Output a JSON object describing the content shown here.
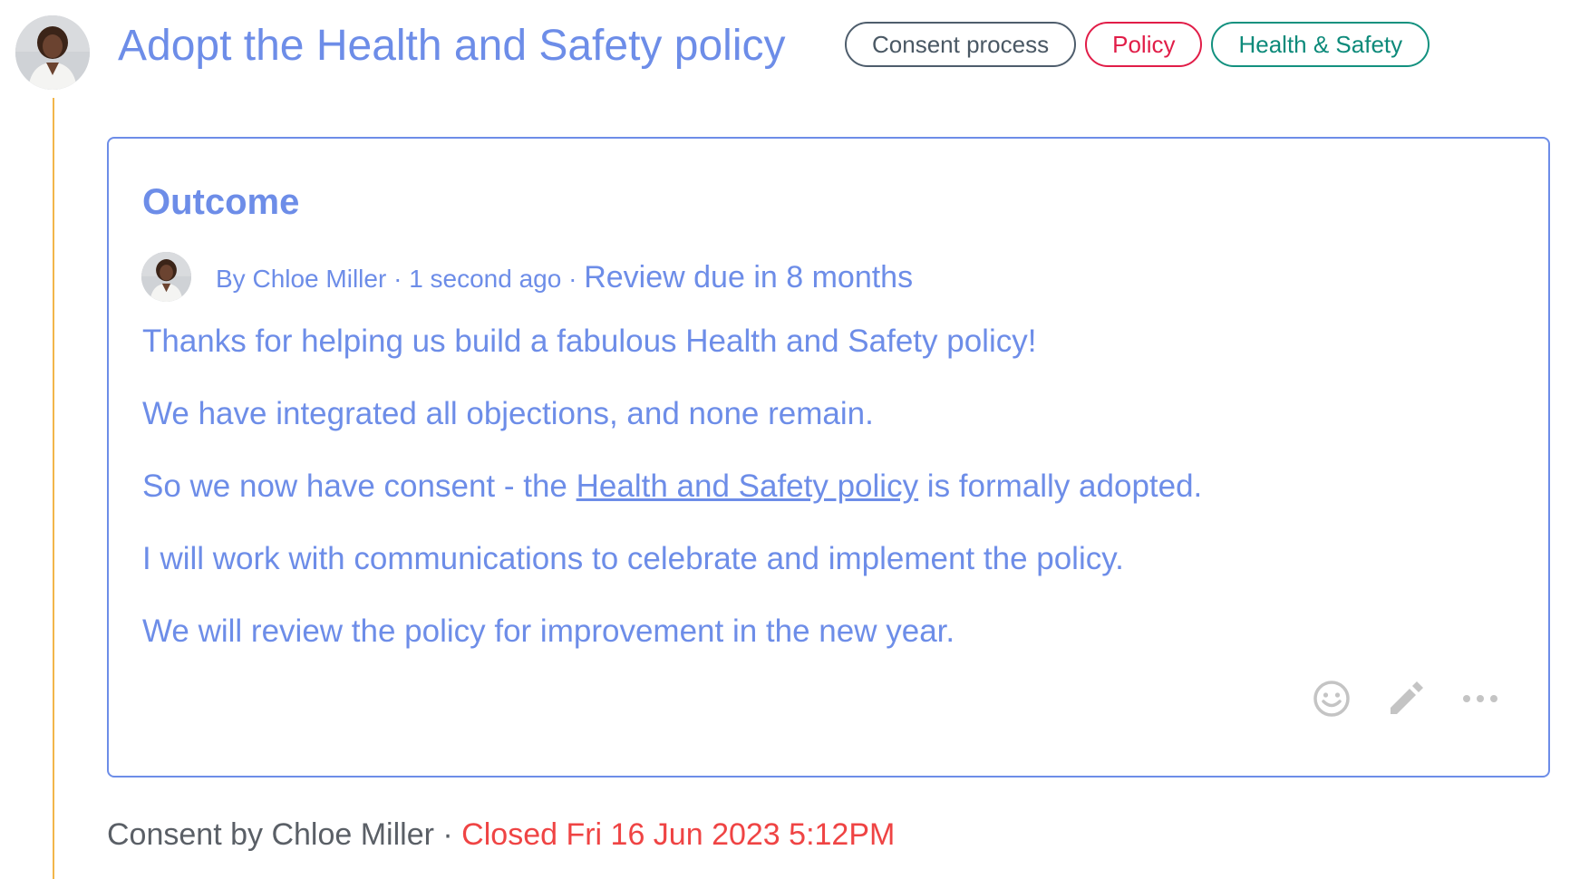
{
  "thread": {
    "title": "Adopt the Health and Safety policy",
    "tags": [
      {
        "label": "Consent process"
      },
      {
        "label": "Policy"
      },
      {
        "label": "Health & Safety"
      }
    ]
  },
  "outcome": {
    "heading": "Outcome",
    "author_prefix": "By ",
    "author": "Chloe Miller",
    "separator": " · ",
    "time_ago": "1 second ago",
    "review_separator": " · ",
    "review": "Review due in 8 months",
    "paragraphs": {
      "p1": "Thanks for helping us build a fabulous Health and Safety policy!",
      "p2": "We have integrated all objections, and none remain.",
      "p3_before": "So we now have consent - the ",
      "p3_link": "Health and Safety policy",
      "p3_after": " is formally adopted.",
      "p4": "I will work with communications to celebrate and implement the policy.",
      "p5": "We will review the policy for improvement in the new year."
    },
    "actions": {
      "react_icon": "smiley-icon",
      "edit_icon": "pencil-icon",
      "more_icon": "more-horizontal-icon"
    }
  },
  "footer": {
    "consent_prefix": "Consent by ",
    "consent_author": "Chloe Miller",
    "separator": " · ",
    "closed": "Closed Fri 16 Jun 2023 5:12PM"
  },
  "colors": {
    "accent": "#6d8de8",
    "thread_line": "#f2b64a",
    "tag_policy": "#e11d48",
    "tag_health": "#0d8a7a",
    "closed": "#ef4444"
  }
}
